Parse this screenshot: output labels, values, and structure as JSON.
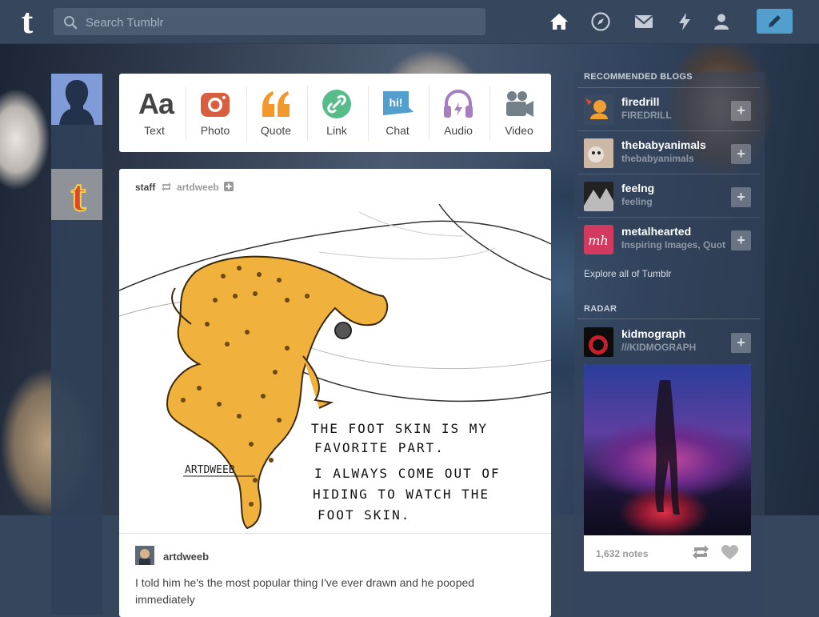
{
  "colors": {
    "nav_bg": "#36465d",
    "accent": "#529ecc",
    "white": "#ffffff"
  },
  "header": {
    "logo": "t",
    "search_placeholder": "Search Tumblr",
    "icons": [
      "home-icon",
      "explore-compass-icon",
      "inbox-envelope-icon",
      "activity-lightning-icon",
      "account-person-icon",
      "compose-pencil-icon"
    ]
  },
  "post_types": [
    {
      "label": "Text",
      "icon": "text-icon",
      "glyph": "Aa",
      "color": "#444444"
    },
    {
      "label": "Photo",
      "icon": "camera-icon",
      "color": "#d95e40"
    },
    {
      "label": "Quote",
      "icon": "quote-icon",
      "glyph": "66",
      "color": "#f2992e"
    },
    {
      "label": "Link",
      "icon": "link-icon",
      "color": "#56bc8a"
    },
    {
      "label": "Chat",
      "icon": "chat-icon",
      "glyph": "hi!",
      "color": "#529ecc"
    },
    {
      "label": "Audio",
      "icon": "headphones-icon",
      "color": "#a77dc2"
    },
    {
      "label": "Video",
      "icon": "video-camera-icon",
      "color": "#748089"
    }
  ],
  "post": {
    "author": "staff",
    "reblogged_from": "artdweeb",
    "image_caption_lines": [
      "THE FOOT SKIN IS MY",
      "FAVORITE PART.",
      "I ALWAYS COME OUT OF",
      "HIDING TO WATCH THE",
      "FOOT SKIN."
    ],
    "signature": "ARTDWEEB",
    "reblog_user": "artdweeb",
    "text": "I told him he's the most popular thing I've ever drawn and he pooped immediately"
  },
  "sidebar": {
    "recommended_title": "RECOMMENDED BLOGS",
    "blogs": [
      {
        "name": "firedrill",
        "subtitle": "FIREDRILL",
        "avatar_color": "#e8a23a"
      },
      {
        "name": "thebabyanimals",
        "subtitle": "thebabyanimals",
        "avatar_color": "#b59a86"
      },
      {
        "name": "feelng",
        "subtitle": "feeling",
        "avatar_color": "#2b2b2b"
      },
      {
        "name": "metalhearted",
        "subtitle": "Inspiring Images, Quotes",
        "avatar_color": "#d43a5f"
      }
    ],
    "follow_label": "+",
    "explore_label": "Explore all of Tumblr",
    "radar_title": "RADAR",
    "radar_blog": {
      "name": "kidmograph",
      "subtitle": "///KIDMOGRAPH",
      "avatar_color": "#1a1a1a"
    },
    "radar_notes": "1,632 notes"
  }
}
